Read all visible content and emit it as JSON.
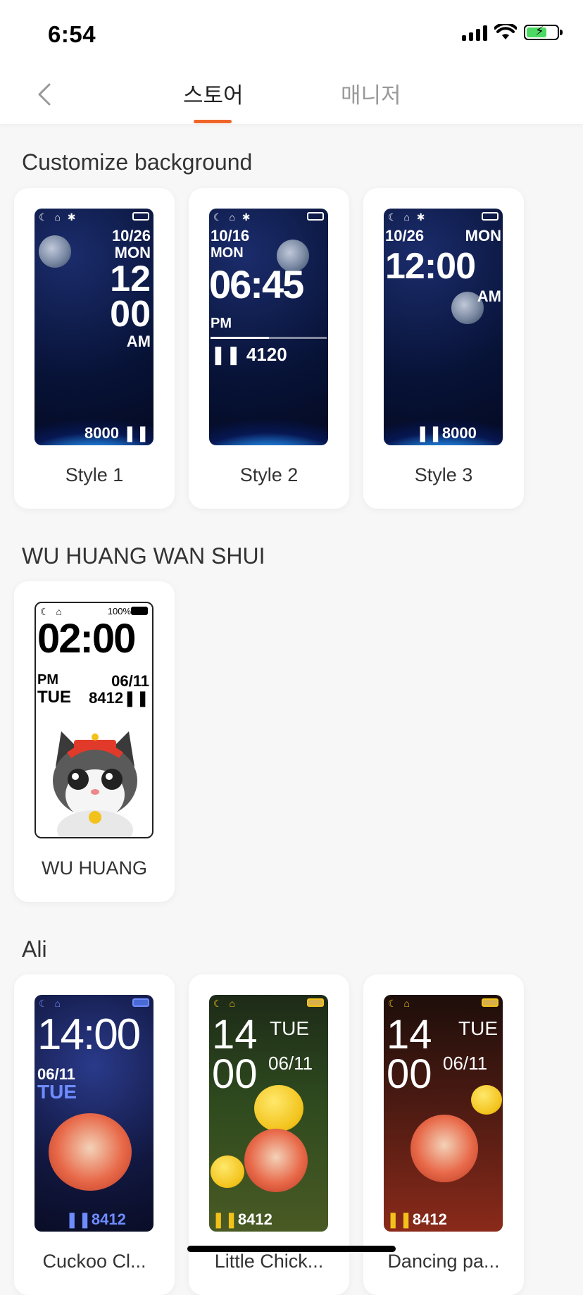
{
  "status": {
    "time": "6:54"
  },
  "nav": {
    "tabs": [
      {
        "label": "스토어",
        "active": true
      },
      {
        "label": "매니저",
        "active": false
      }
    ]
  },
  "sections": [
    {
      "title": "Customize background",
      "items": [
        {
          "label": "Style 1",
          "face": {
            "date": "10/26",
            "day": "MON",
            "hour": "12",
            "min": "00",
            "ampm": "AM",
            "steps": "8000"
          }
        },
        {
          "label": "Style 2",
          "face": {
            "date": "10/16",
            "day": "MON",
            "time": "06:45",
            "ampm": "PM",
            "steps": "4120"
          }
        },
        {
          "label": "Style 3",
          "face": {
            "date": "10/26",
            "day": "MON",
            "time": "12:00",
            "ampm": "AM",
            "steps": "8000"
          }
        }
      ]
    },
    {
      "title": "WU HUANG WAN SHUI",
      "items": [
        {
          "label": "WU HUANG",
          "face": {
            "battery": "100%",
            "time": "02:00",
            "ampm": "PM",
            "date": "06/11",
            "day": "TUE",
            "steps": "8412"
          }
        }
      ]
    },
    {
      "title": "Ali",
      "items": [
        {
          "label": "Cuckoo Cl...",
          "face": {
            "time": "14:00",
            "date": "06/11",
            "day": "TUE",
            "steps": "8412"
          }
        },
        {
          "label": "Little Chick...",
          "face": {
            "hour": "14",
            "min": "00",
            "day": "TUE",
            "date": "06/11",
            "steps": "8412"
          }
        },
        {
          "label": "Dancing pa...",
          "face": {
            "hour": "14",
            "min": "00",
            "day": "TUE",
            "date": "06/11",
            "steps": "8412"
          }
        }
      ]
    }
  ]
}
